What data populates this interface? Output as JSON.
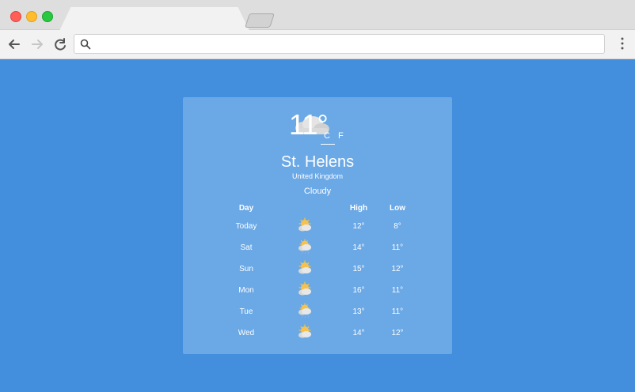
{
  "browser": {
    "tab_title": "",
    "address_value": ""
  },
  "weather": {
    "temperature": "11°",
    "units": {
      "celsius": "C",
      "fahrenheit": "F",
      "selected": "C"
    },
    "location": {
      "city": "St. Helens",
      "country": "United Kingdom"
    },
    "condition": "Cloudy",
    "colors": {
      "background": "#448fdd",
      "card": "#6aa8e6",
      "text": "#ffffff"
    },
    "forecast_headers": {
      "day": "Day",
      "high": "High",
      "low": "Low"
    },
    "forecast": [
      {
        "day": "Today",
        "icon": "partly-cloudy-icon",
        "high": "12°",
        "low": "8°"
      },
      {
        "day": "Sat",
        "icon": "rain-cloud-icon",
        "high": "14°",
        "low": "11°"
      },
      {
        "day": "Sun",
        "icon": "partly-cloudy-icon",
        "high": "15°",
        "low": "12°"
      },
      {
        "day": "Mon",
        "icon": "partly-cloudy-icon",
        "high": "16°",
        "low": "11°"
      },
      {
        "day": "Tue",
        "icon": "rain-cloud-icon",
        "high": "13°",
        "low": "11°"
      },
      {
        "day": "Wed",
        "icon": "partly-cloudy-icon",
        "high": "14°",
        "low": "12°"
      }
    ]
  }
}
